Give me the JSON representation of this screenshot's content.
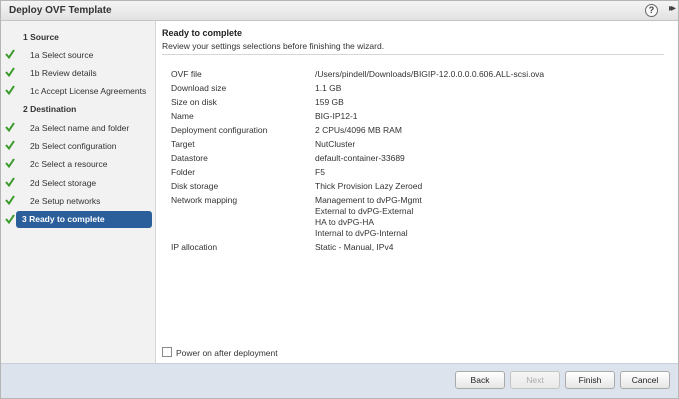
{
  "window": {
    "title": "Deploy OVF Template",
    "help_glyph": "?",
    "expand_glyph": "▸▸"
  },
  "sidebar": {
    "steps": [
      {
        "number": "1",
        "label": "Source",
        "completed": false,
        "active": false,
        "heading": true
      },
      {
        "number": "1a",
        "label": "Select source",
        "completed": true,
        "active": false,
        "heading": false
      },
      {
        "number": "1b",
        "label": "Review details",
        "completed": true,
        "active": false,
        "heading": false
      },
      {
        "number": "1c",
        "label": "Accept License Agreements",
        "completed": true,
        "active": false,
        "heading": false
      },
      {
        "number": "2",
        "label": "Destination",
        "completed": false,
        "active": false,
        "heading": true
      },
      {
        "number": "2a",
        "label": "Select name and folder",
        "completed": true,
        "active": false,
        "heading": false
      },
      {
        "number": "2b",
        "label": "Select configuration",
        "completed": true,
        "active": false,
        "heading": false
      },
      {
        "number": "2c",
        "label": "Select a resource",
        "completed": true,
        "active": false,
        "heading": false
      },
      {
        "number": "2d",
        "label": "Select storage",
        "completed": true,
        "active": false,
        "heading": false
      },
      {
        "number": "2e",
        "label": "Setup networks",
        "completed": true,
        "active": false,
        "heading": false
      },
      {
        "number": "3",
        "label": "Ready to complete",
        "completed": true,
        "active": true,
        "heading": true
      }
    ],
    "step_text": [
      "1  Source",
      "1a  Select source",
      "1b  Review details",
      "1c  Accept License Agreements",
      "2  Destination",
      "2a  Select name and folder",
      "2b  Select configuration",
      "2c  Select a resource",
      "2d  Select storage",
      "2e  Setup networks",
      "3  Ready to complete"
    ]
  },
  "main": {
    "title": "Ready to complete",
    "subtitle": "Review your settings selections before finishing the wizard.",
    "settings": [
      {
        "key": "OVF file",
        "value": "/Users/pindell/Downloads/BIGIP-12.0.0.0.0.606.ALL-scsi.ova"
      },
      {
        "key": "Download size",
        "value": "1.1 GB"
      },
      {
        "key": "Size on disk",
        "value": "159 GB"
      },
      {
        "key": "Name",
        "value": "BIG-IP12-1"
      },
      {
        "key": "Deployment configuration",
        "value": "2 CPUs/4096 MB RAM"
      },
      {
        "key": "Target",
        "value": "NutCluster"
      },
      {
        "key": "Datastore",
        "value": "default-container-33689"
      },
      {
        "key": "Folder",
        "value": "F5"
      },
      {
        "key": "Disk storage",
        "value": "Thick Provision Lazy Zeroed"
      },
      {
        "key": "Network mapping",
        "value": "Management to dvPG-Mgmt"
      },
      {
        "key": "",
        "value": "External to dvPG-External"
      },
      {
        "key": "",
        "value": "HA to dvPG-HA"
      },
      {
        "key": "",
        "value": "Internal to dvPG-Internal"
      },
      {
        "key": "IP allocation",
        "value": "Static - Manual, IPv4"
      }
    ],
    "power_on_label": "Power on after deployment",
    "power_on_checked": false
  },
  "footer": {
    "back_label": "Back",
    "next_label": "Next",
    "finish_label": "Finish",
    "cancel_label": "Cancel"
  },
  "colors": {
    "active_step_bg": "#2b5f9c",
    "check_green": "#3a9a2a",
    "footer_bg": "#dde3ec"
  }
}
